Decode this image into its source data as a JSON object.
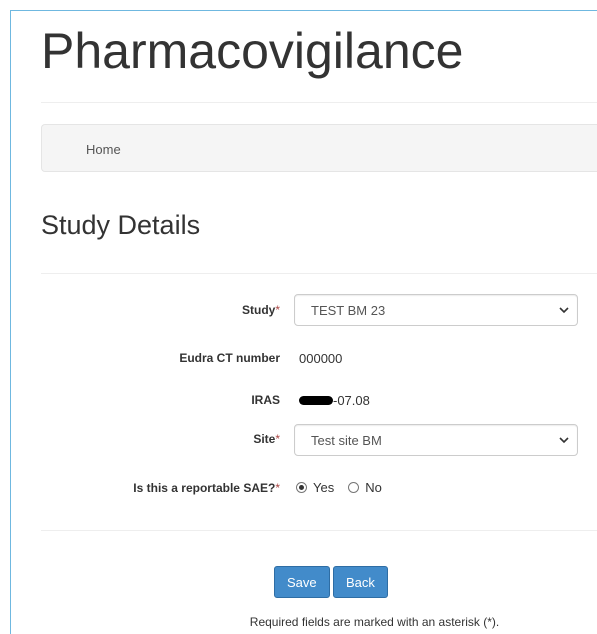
{
  "header": {
    "title": "Pharmacovigilance"
  },
  "breadcrumb": {
    "home": "Home"
  },
  "section": {
    "title": "Study Details"
  },
  "form": {
    "study": {
      "label": "Study",
      "required_mark": "*",
      "value": "TEST BM 23"
    },
    "eudra": {
      "label": "Eudra CT number",
      "value": "000000"
    },
    "iras": {
      "label": "IRAS",
      "value": "-07.08"
    },
    "site": {
      "label": "Site",
      "required_mark": "*",
      "value": "Test site BM"
    },
    "reportable": {
      "label": "Is this a reportable SAE?",
      "required_mark": "*",
      "options": [
        "Yes",
        "No"
      ],
      "selected": "Yes"
    }
  },
  "actions": {
    "save": "Save",
    "back": "Back"
  },
  "footer": {
    "note": "Required fields are marked with an asterisk (*)."
  },
  "colors": {
    "primary": "#428bca",
    "frame": "#6fb8e0",
    "breadcrumb_bg": "#f5f5f5"
  }
}
